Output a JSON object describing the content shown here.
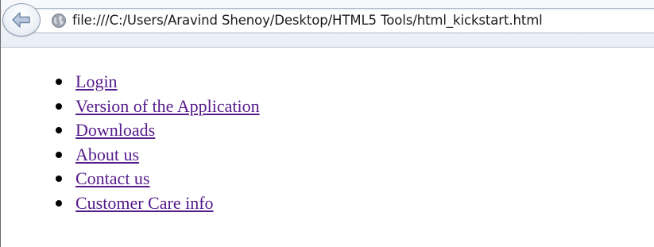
{
  "browser": {
    "url": "file:///C:/Users/Aravind Shenoy/Desktop/HTML5 Tools/html_kickstart.html",
    "back_icon": "back-arrow-icon",
    "site_icon": "globe-icon"
  },
  "page": {
    "links": [
      {
        "label": "Login"
      },
      {
        "label": "Version of the Application"
      },
      {
        "label": "Downloads"
      },
      {
        "label": "About us"
      },
      {
        "label": "Contact us"
      },
      {
        "label": "Customer Care info"
      }
    ],
    "link_color": "#551a8b"
  }
}
